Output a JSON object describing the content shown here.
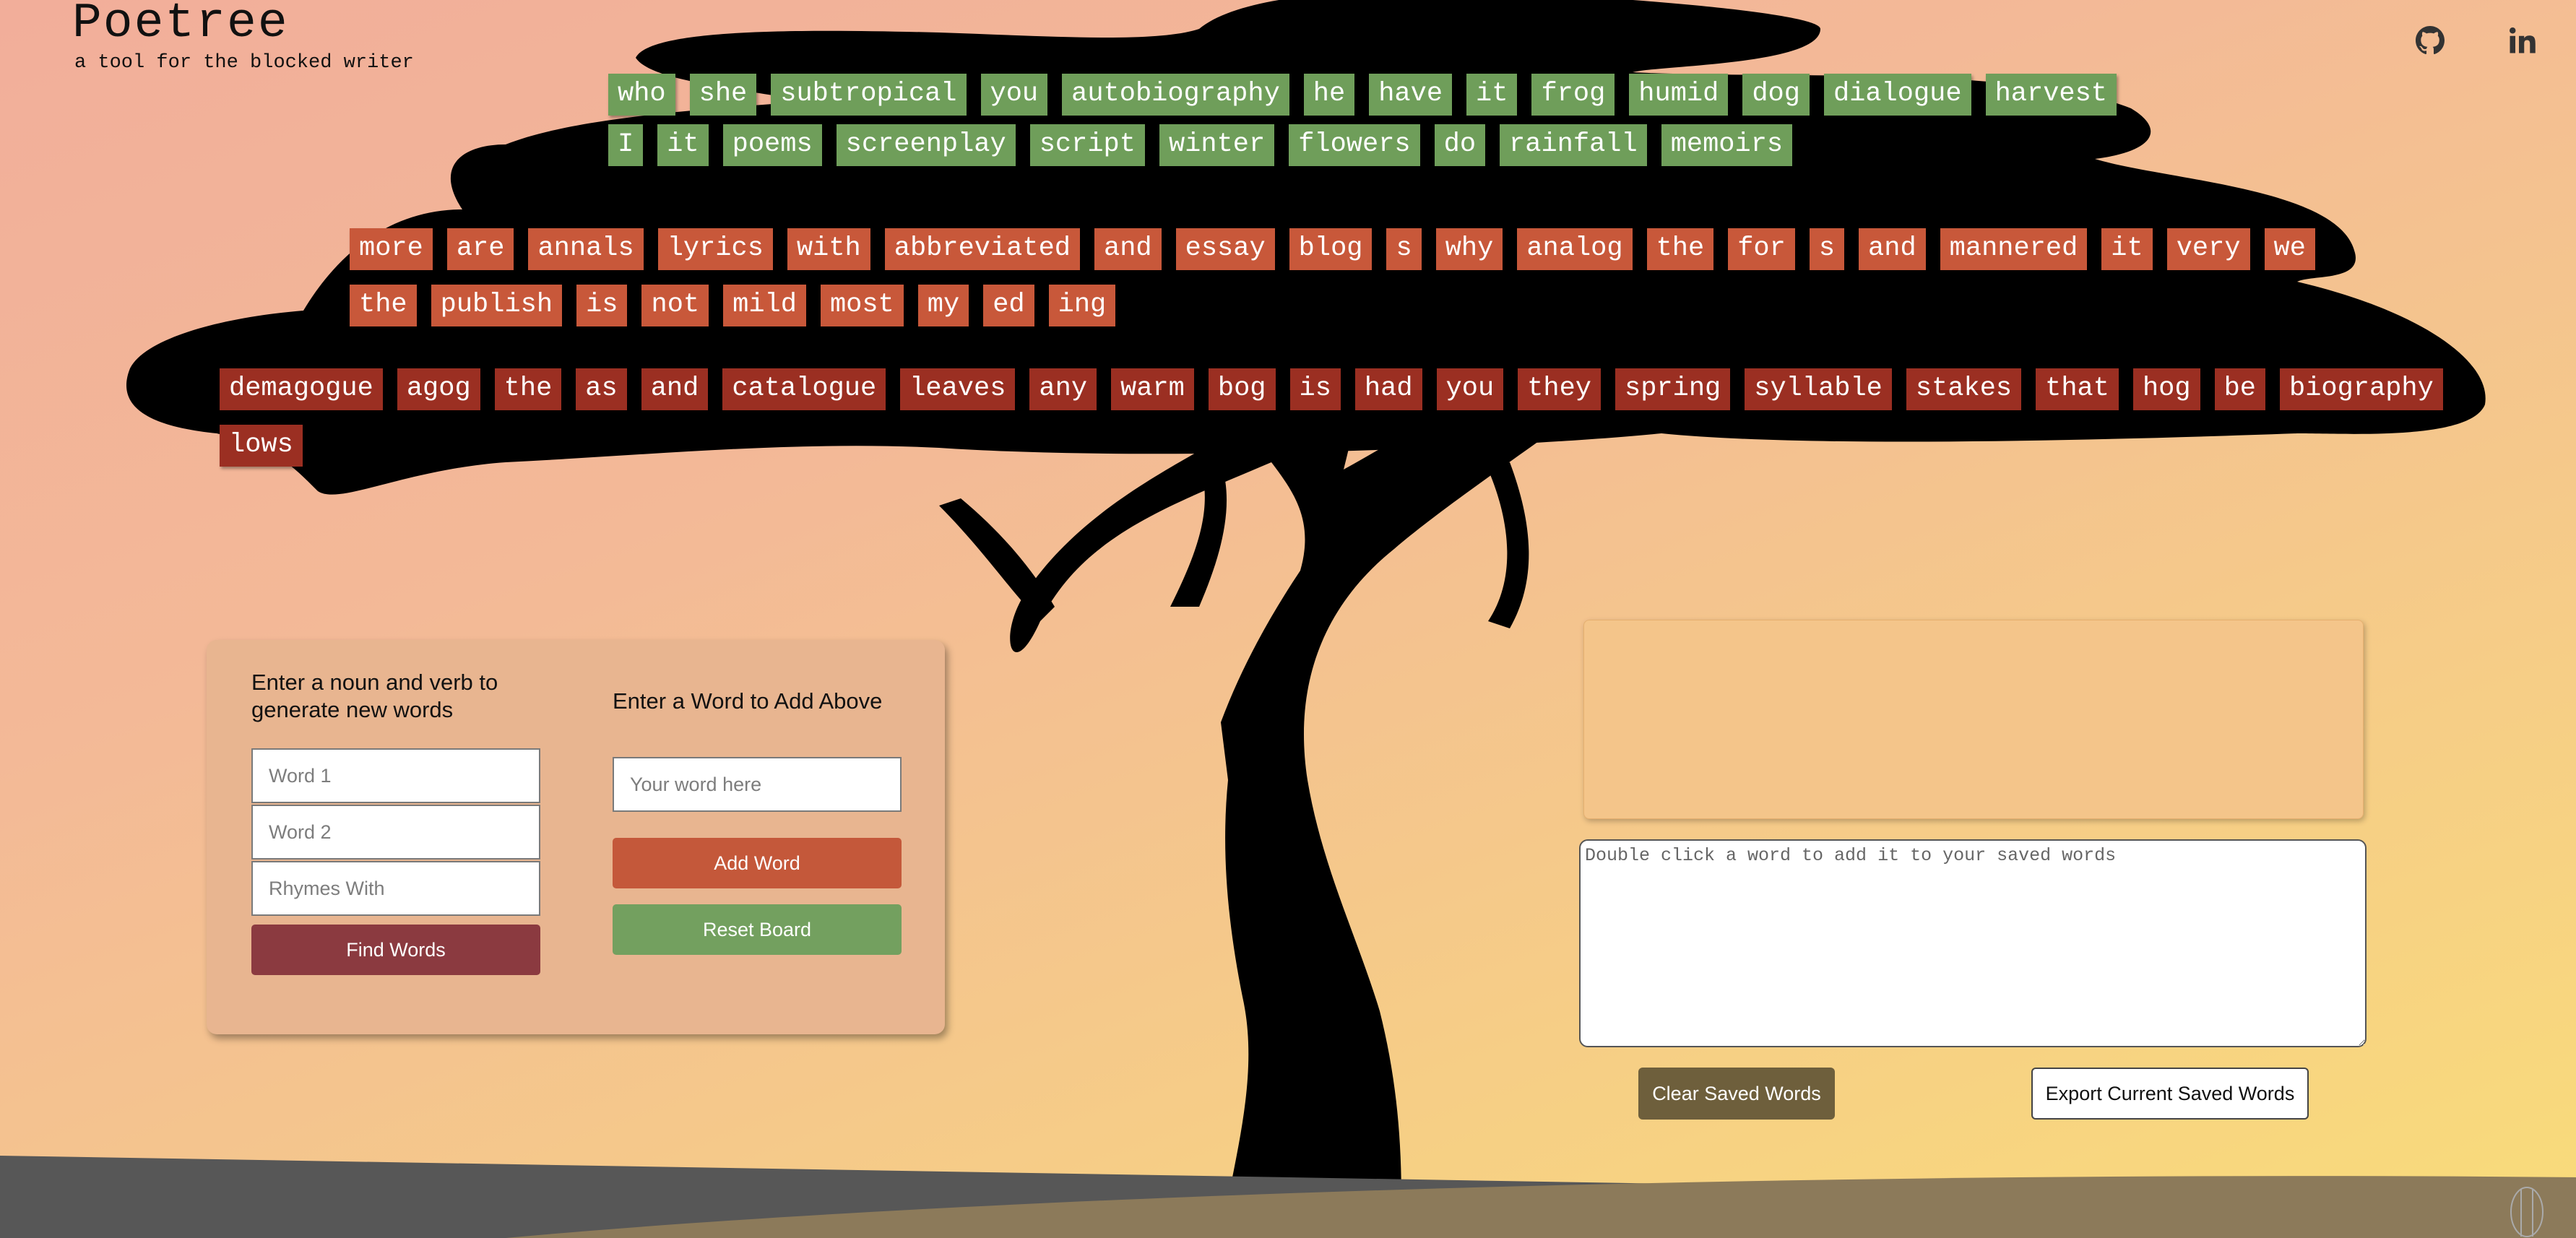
{
  "header": {
    "title": "Poetree",
    "subtitle": "a tool for the blocked writer",
    "github_icon": "github-icon",
    "linkedin_icon": "linkedin-icon"
  },
  "colors": {
    "tile_green": "#6f9e5a",
    "tile_orange": "#c8583a",
    "tile_red": "#9b2f22",
    "find_button": "#8b3a40",
    "add_button": "#c4583a",
    "reset_button": "#73a05f",
    "clear_button": "#6e5f3c"
  },
  "words": {
    "row1": [
      "who",
      "she",
      "subtropical",
      "you",
      "autobiography",
      "he",
      "have",
      "it",
      "frog",
      "humid",
      "dog",
      "dialogue",
      "harvest",
      "I",
      "it",
      "poems",
      "screenplay",
      "script",
      "winter",
      "flowers",
      "do",
      "rainfall",
      "memoirs"
    ],
    "row2": [
      "more",
      "are",
      "annals",
      "lyrics",
      "with",
      "abbreviated",
      "and",
      "essay",
      "blog",
      "s",
      "why",
      "analog",
      "the",
      "for",
      "s",
      "and",
      "mannered",
      "it",
      "very",
      "we",
      "the",
      "publish",
      "is",
      "not",
      "mild",
      "most",
      "my",
      "ed",
      "ing"
    ],
    "row3": [
      "demagogue",
      "agog",
      "the",
      "as",
      "and",
      "catalogue",
      "leaves",
      "any",
      "warm",
      "bog",
      "is",
      "had",
      "you",
      "they",
      "spring",
      "syllable",
      "stakes",
      "that",
      "hog",
      "be",
      "biography",
      "lows"
    ]
  },
  "generator": {
    "heading": "Enter a noun and verb to generate new words",
    "word1_placeholder": "Word 1",
    "word2_placeholder": "Word 2",
    "rhymes_placeholder": "Rhymes With",
    "find_label": "Find Words"
  },
  "adder": {
    "heading": "Enter a Word to Add Above",
    "word_placeholder": "Your word here",
    "add_label": "Add Word",
    "reset_label": "Reset Board"
  },
  "saved": {
    "textarea_placeholder": "Double click a word to add it to your saved words",
    "clear_label": "Clear Saved Words",
    "export_label": "Export Current Saved Words"
  }
}
